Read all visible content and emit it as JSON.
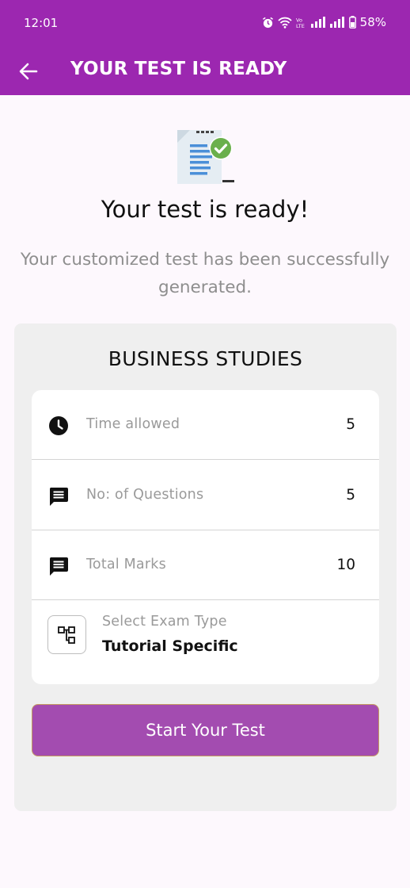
{
  "status_bar": {
    "time": "12:01",
    "battery": "58%"
  },
  "app_bar": {
    "title": "YOUR TEST IS READY"
  },
  "hero": {
    "headline": "Your test is ready!",
    "subheading": "Your customized test has been successfully generated."
  },
  "panel": {
    "subject": "BUSINESS STUDIES",
    "rows": [
      {
        "label": "Time allowed",
        "value": "5",
        "icon": "clock-icon"
      },
      {
        "label": "No: of Questions",
        "value": "5",
        "icon": "message-icon"
      },
      {
        "label": "Total Marks",
        "value": "10",
        "icon": "message-icon"
      }
    ],
    "exam_type": {
      "label": "Select Exam Type",
      "value": "Tutorial Specific",
      "icon": "hierarchy-icon"
    },
    "start_button": "Start Your Test"
  },
  "colors": {
    "brand": "#9c27b0",
    "button": "#a34cb0",
    "check": "#6ab04c"
  }
}
